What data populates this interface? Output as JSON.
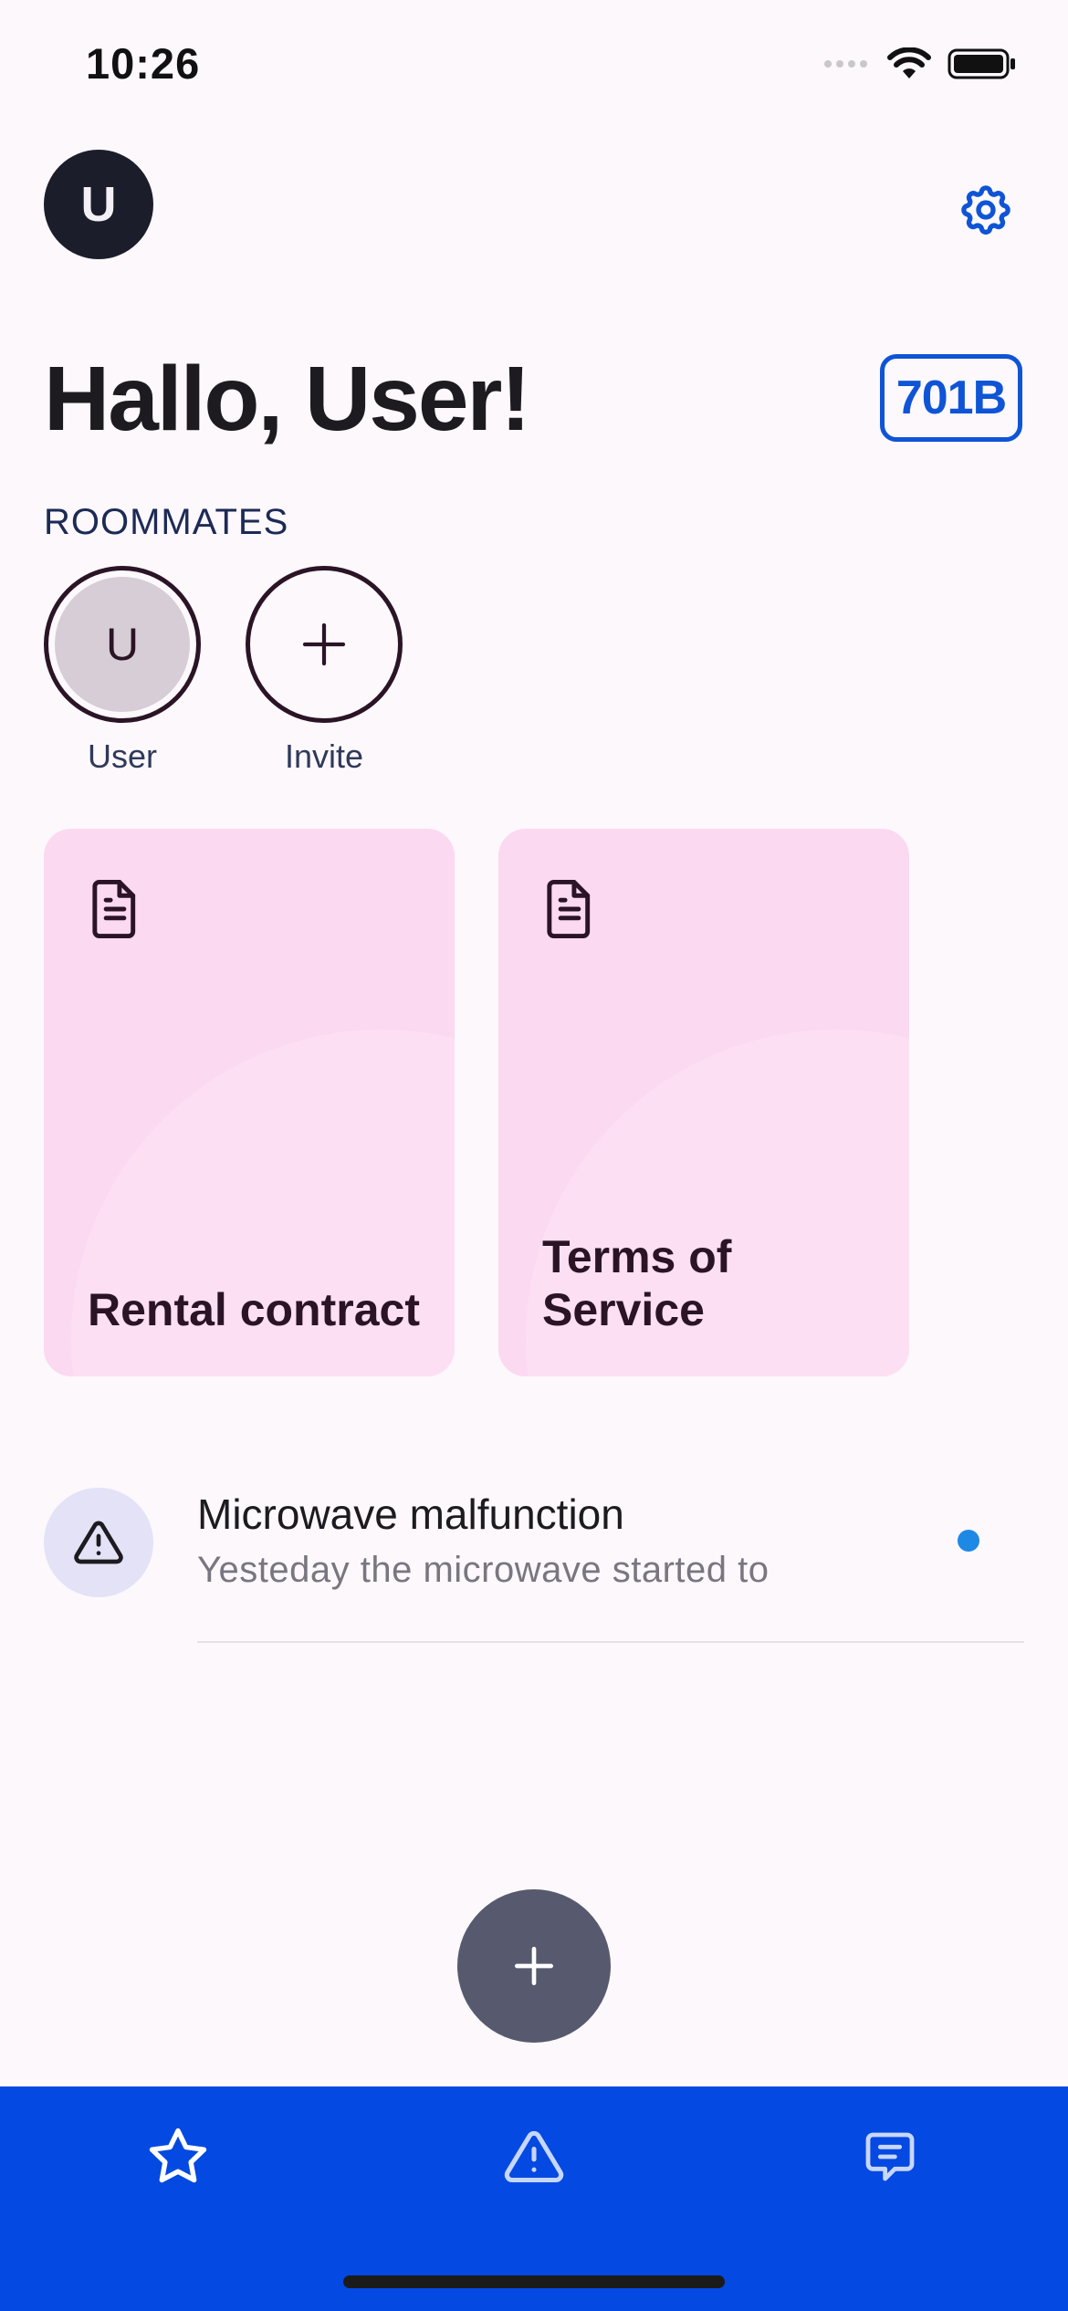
{
  "status_bar": {
    "time": "10:26"
  },
  "header": {
    "avatar_initial": "U"
  },
  "greeting": "Hallo, User!",
  "room_code": "701B",
  "roommates": {
    "section_label": "ROOMMATES",
    "members": [
      {
        "initial": "U",
        "name": "User"
      }
    ],
    "invite_label": "Invite"
  },
  "documents": [
    {
      "title": "Rental contract",
      "icon": "document-icon"
    },
    {
      "title": "Terms of Service",
      "icon": "document-icon"
    }
  ],
  "issues": [
    {
      "icon": "warning-icon",
      "title": "Microwave malfunction",
      "preview": "Yesteday the microwave started to",
      "unread": true
    }
  ],
  "bottom_nav": {
    "items": [
      {
        "icon": "star-icon"
      },
      {
        "icon": "warning-icon"
      },
      {
        "icon": "chat-icon"
      }
    ]
  },
  "colors": {
    "accent_blue": "#0f54d6",
    "nav_blue": "#0349e2",
    "card_pink": "#fbd9f1",
    "fab_gray": "#575a6e",
    "unread_dot": "#1e88e5"
  }
}
